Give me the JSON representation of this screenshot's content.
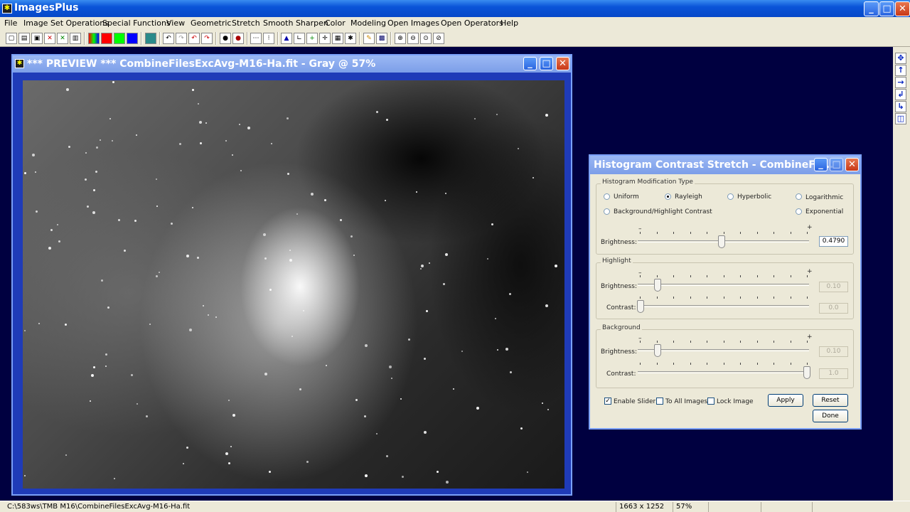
{
  "app": {
    "title": "ImagesPlus"
  },
  "menu": [
    "File",
    "Image Set Operations",
    "Special Functions",
    "View",
    "Geometric",
    "Stretch",
    "Smooth Sharpen",
    "Color",
    "Modeling",
    "Open Images",
    "Open Operators",
    "Help"
  ],
  "preview": {
    "title": "*** PREVIEW *** CombineFilesExcAvg-M16-Ha.fit - Gray @ 57%"
  },
  "dialog": {
    "title": "Histogram Contrast Stretch - CombineFil...",
    "modification": {
      "legend": "Histogram Modification Type",
      "options": {
        "uniform": "Uniform",
        "rayleigh": "Rayleigh",
        "hyperbolic": "Hyperbolic",
        "logarithmic": "Logarithmic",
        "bg_highlight": "Background/Highlight Contrast",
        "exponential": "Exponential"
      },
      "brightness_label": "Brightness:",
      "brightness_value": "0.4790"
    },
    "highlight": {
      "legend": "Highlight",
      "brightness_label": "Brightness:",
      "brightness_value": "0.10",
      "contrast_label": "Contrast:",
      "contrast_value": "0.0"
    },
    "background": {
      "legend": "Background",
      "brightness_label": "Brightness:",
      "brightness_value": "0.10",
      "contrast_label": "Contrast:",
      "contrast_value": "1.0"
    },
    "minus": "–",
    "plus": "+",
    "enable_slider": "Enable Slider",
    "to_all_images": "To All Images",
    "lock_image": "Lock Image",
    "apply": "Apply",
    "reset": "Reset",
    "done": "Done"
  },
  "status": {
    "path": "C:\\583ws\\TMB M16\\CombineFilesExcAvg-M16-Ha.fit",
    "dims": "1663 x 1252",
    "zoom": "57%"
  }
}
